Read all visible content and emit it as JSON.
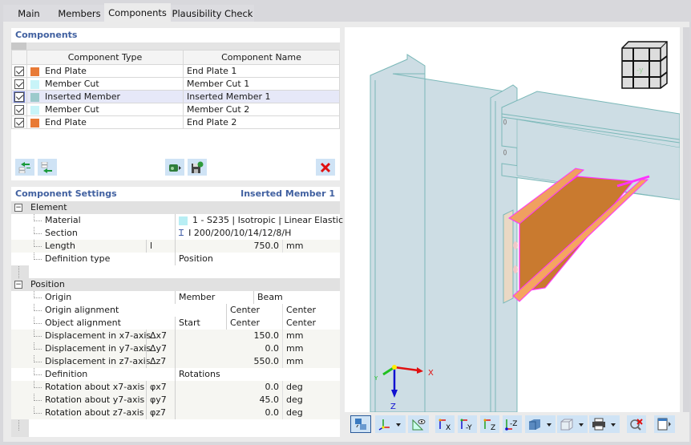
{
  "tabs": [
    {
      "label": "Main",
      "active": false
    },
    {
      "label": "Members",
      "active": false
    },
    {
      "label": "Components",
      "active": true
    },
    {
      "label": "Plausibility Check",
      "active": false
    }
  ],
  "components": {
    "title": "Components",
    "columns": [
      "Component Type",
      "Component Name"
    ],
    "rows": [
      {
        "checked": true,
        "type": "End Plate",
        "name": "End Plate 1",
        "color": "#e87a36",
        "selected": false
      },
      {
        "checked": true,
        "type": "Member Cut",
        "name": "Member Cut 1",
        "color": "#c8f4f8",
        "selected": false
      },
      {
        "checked": true,
        "type": "Inserted Member",
        "name": "Inserted Member 1",
        "color": "#9ccacc",
        "selected": true
      },
      {
        "checked": true,
        "type": "Member Cut",
        "name": "Member Cut 2",
        "color": "#c8f4f8",
        "selected": false
      },
      {
        "checked": true,
        "type": "End Plate",
        "name": "End Plate 2",
        "color": "#e87a36",
        "selected": false
      }
    ],
    "toolbar": [
      "move-up-icon",
      "move-down-icon",
      "import-icon",
      "save-icon",
      "delete-icon"
    ]
  },
  "settings": {
    "title": "Component Settings",
    "selected": "Inserted Member 1",
    "element": {
      "label": "Element",
      "rows": [
        {
          "label": "Material",
          "symbol": "",
          "value": "1 - S235 | Isotropic | Linear Elastic",
          "unit": "",
          "swatch": "#b8eef4"
        },
        {
          "label": "Section",
          "symbol": "",
          "value": "I 200/200/10/14/12/8/H",
          "unit": "",
          "icon": "I"
        },
        {
          "label": "Length",
          "symbol": "l",
          "value": "750.0",
          "unit": "mm"
        },
        {
          "label": "Definition type",
          "symbol": "",
          "value": "Position",
          "unit": ""
        }
      ]
    },
    "position": {
      "label": "Position",
      "origin": {
        "label": "Origin",
        "v1": "Member",
        "v2": "Beam"
      },
      "origin_alignment": {
        "label": "Origin alignment",
        "v1": "",
        "v2": "Center",
        "v3": "Center"
      },
      "object_alignment": {
        "label": "Object alignment",
        "v1": "Start",
        "v2": "Center",
        "v3": "Center"
      },
      "rows": [
        {
          "label": "Displacement in x7-axis",
          "symbol": "Δx7",
          "value": "150.0",
          "unit": "mm"
        },
        {
          "label": "Displacement in y7-axis",
          "symbol": "Δy7",
          "value": "0.0",
          "unit": "mm"
        },
        {
          "label": "Displacement in z7-axis",
          "symbol": "Δz7",
          "value": "550.0",
          "unit": "mm"
        },
        {
          "label": "Definition",
          "symbol": "",
          "value": "Rotations",
          "unit": "",
          "text": true
        },
        {
          "label": "Rotation about x7-axis",
          "symbol": "φx7",
          "value": "0.0",
          "unit": "deg"
        },
        {
          "label": "Rotation about y7-axis",
          "symbol": "φy7",
          "value": "45.0",
          "unit": "deg"
        },
        {
          "label": "Rotation about z7-axis",
          "symbol": "φz7",
          "value": "0.0",
          "unit": "deg"
        }
      ]
    }
  },
  "view": {
    "axes": {
      "x": "X",
      "y": "Y",
      "z": "Z"
    },
    "cube_label": "-y",
    "toolbar": [
      "view-settings-icon",
      "axes-icon",
      "measure-icon",
      "view-x-icon",
      "view-neg-y-icon",
      "view-z-icon",
      "view-neg-z-icon",
      "render-solid-icon",
      "render-transparent-icon",
      "print-icon",
      "reset-selection-icon",
      "panel-toggle-icon"
    ],
    "view_labels": {
      "x": "X",
      "ny": "-Y",
      "z": "Z",
      "nz": "-Z"
    }
  }
}
